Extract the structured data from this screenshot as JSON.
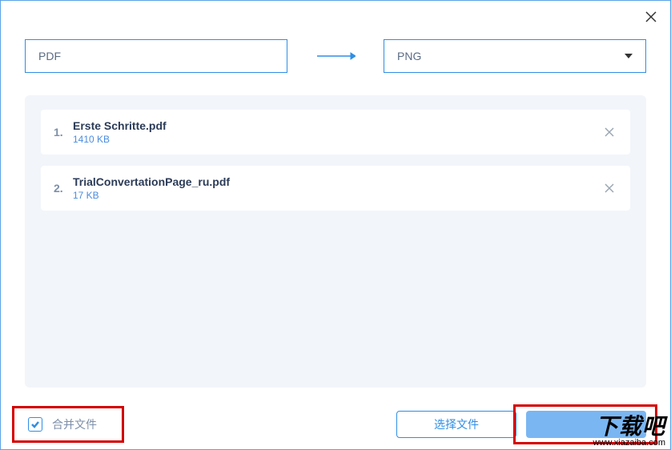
{
  "formats": {
    "source": "PDF",
    "target": "PNG"
  },
  "files": [
    {
      "index": "1.",
      "name": "Erste Schritte.pdf",
      "size": "1410 KB"
    },
    {
      "index": "2.",
      "name": "TrialConvertationPage_ru.pdf",
      "size": "17 KB"
    }
  ],
  "controls": {
    "merge_label": "合并文件",
    "merge_checked": true,
    "select_file": "选择文件",
    "primary": ""
  },
  "watermark": {
    "text": "下载吧",
    "url": "www.xiazaiba.com"
  }
}
